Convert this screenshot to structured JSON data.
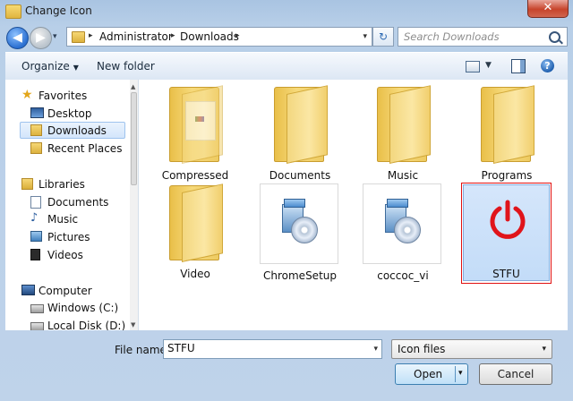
{
  "window": {
    "title": "Change Icon",
    "close_glyph": "✕"
  },
  "nav": {
    "back_glyph": "◀",
    "forward_glyph": "▶",
    "dropdown_glyph": "▾"
  },
  "address": {
    "crumbs": [
      "Administrator",
      "Downloads"
    ],
    "separator": "▸",
    "dropdown_glyph": "▾",
    "refresh_glyph": "↻"
  },
  "search": {
    "placeholder": "Search Downloads"
  },
  "toolbar": {
    "organize_label": "Organize",
    "organize_dd": "▼",
    "new_folder_label": "New folder",
    "view_dd": "▼",
    "help_glyph": "?"
  },
  "sidebar": {
    "groups": [
      {
        "label": "Favorites",
        "icon": "star-icon",
        "items": [
          {
            "label": "Desktop",
            "icon": "desktop-icon"
          },
          {
            "label": "Downloads",
            "icon": "downloads-icon",
            "selected": true
          },
          {
            "label": "Recent Places",
            "icon": "recent-places-icon"
          }
        ]
      },
      {
        "label": "Libraries",
        "icon": "libraries-icon",
        "items": [
          {
            "label": "Documents",
            "icon": "documents-icon"
          },
          {
            "label": "Music",
            "icon": "music-icon"
          },
          {
            "label": "Pictures",
            "icon": "pictures-icon"
          },
          {
            "label": "Videos",
            "icon": "videos-icon"
          }
        ]
      },
      {
        "label": "Computer",
        "icon": "computer-icon",
        "items": [
          {
            "label": "Windows (C:)",
            "icon": "drive-icon"
          },
          {
            "label": "Local Disk (D:)",
            "icon": "drive-icon"
          }
        ]
      }
    ],
    "scroll_up": "▲",
    "scroll_down": "▼"
  },
  "files": [
    {
      "name": "Compressed",
      "type": "folder"
    },
    {
      "name": "Documents",
      "type": "folder"
    },
    {
      "name": "Music",
      "type": "folder"
    },
    {
      "name": "Programs",
      "type": "folder"
    },
    {
      "name": "Video",
      "type": "folder"
    },
    {
      "name": "ChromeSetup",
      "type": "setup"
    },
    {
      "name": "coccoc_vi",
      "type": "setup"
    },
    {
      "name": "STFU",
      "type": "icon",
      "selected": true
    }
  ],
  "colors": {
    "accent": "#e01010",
    "selection": "#c3dcf8",
    "power": "#e0141b"
  },
  "footer": {
    "file_name_label": "File name:",
    "file_name_value": "STFU",
    "file_type_selected": "Icon files",
    "dropdown_glyph": "▾",
    "open_label": "Open",
    "open_dd": "▾",
    "cancel_label": "Cancel"
  }
}
